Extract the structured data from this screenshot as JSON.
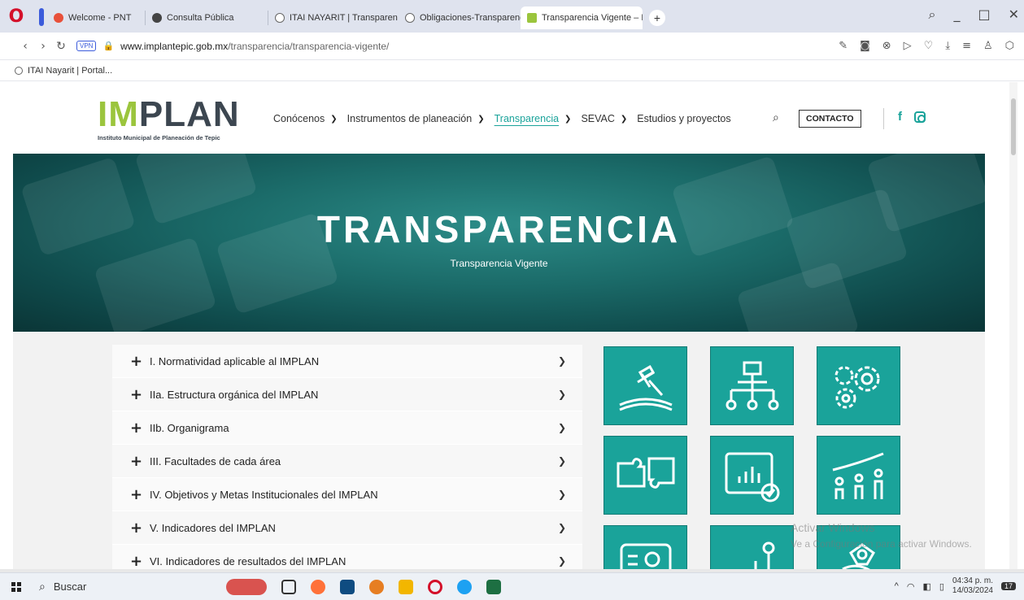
{
  "browser": {
    "tabs": [
      {
        "label": "Welcome - PNT",
        "icon": "pnt-icon",
        "active": false
      },
      {
        "label": "Consulta Pública",
        "icon": "globe-icon",
        "active": false
      },
      {
        "label": "ITAI NAYARIT | Transparen",
        "icon": "itai-icon",
        "active": false
      },
      {
        "label": "Obligaciones-Transparenc",
        "icon": "itai-icon",
        "active": false
      },
      {
        "label": "Transparencia Vigente – IN",
        "icon": "implan-icon",
        "active": true
      }
    ],
    "url_domain": "www.implantepic.gob.mx",
    "url_path": "/transparencia/transparencia-vigente/",
    "vpn_label": "VPN",
    "bookmark": "ITAI Nayarit | Portal..."
  },
  "site": {
    "logo_text_prefix": "IM",
    "logo_text": "PLAN",
    "logo_subtitle": "Instituto Municipal de Planeación de Tepic",
    "menu": [
      {
        "label": "Conócenos",
        "dropdown": true,
        "current": false
      },
      {
        "label": "Instrumentos de planeación",
        "dropdown": true,
        "current": false
      },
      {
        "label": "Transparencia",
        "dropdown": true,
        "current": true
      },
      {
        "label": "SEVAC",
        "dropdown": true,
        "current": false
      },
      {
        "label": "Estudios y proyectos",
        "dropdown": false,
        "current": false
      }
    ],
    "contact_label": "CONTACTO"
  },
  "hero": {
    "title": "TRANSPARENCIA",
    "subtitle": "Transparencia Vigente"
  },
  "accordion": [
    "I. Normatividad aplicable al IMPLAN",
    "IIa. Estructura orgánica del IMPLAN",
    "IIb. Organigrama",
    "III. Facultades de cada área",
    "IV. Objetivos y Metas Institucionales del IMPLAN",
    "V. Indicadores del IMPLAN",
    "VI. Indicadores de resultados del IMPLAN"
  ],
  "tiles": [
    "law-icon",
    "org-chart-icon",
    "gears-icon",
    "puzzle-icon",
    "report-chart-icon",
    "growth-people-icon",
    "id-card-icon",
    "person-icon",
    "hand-money-icon"
  ],
  "watermark": {
    "line1": "Activar Windows",
    "line2": "Ve a Configuración para activar Windows."
  },
  "taskbar": {
    "search_label": "Buscar",
    "time": "04:34 p. m.",
    "date": "14/03/2024",
    "notifications": "17"
  },
  "colors": {
    "accent": "#1aa39a",
    "hero_dark": "#0f4a4b",
    "opera_red": "#d4102a"
  }
}
